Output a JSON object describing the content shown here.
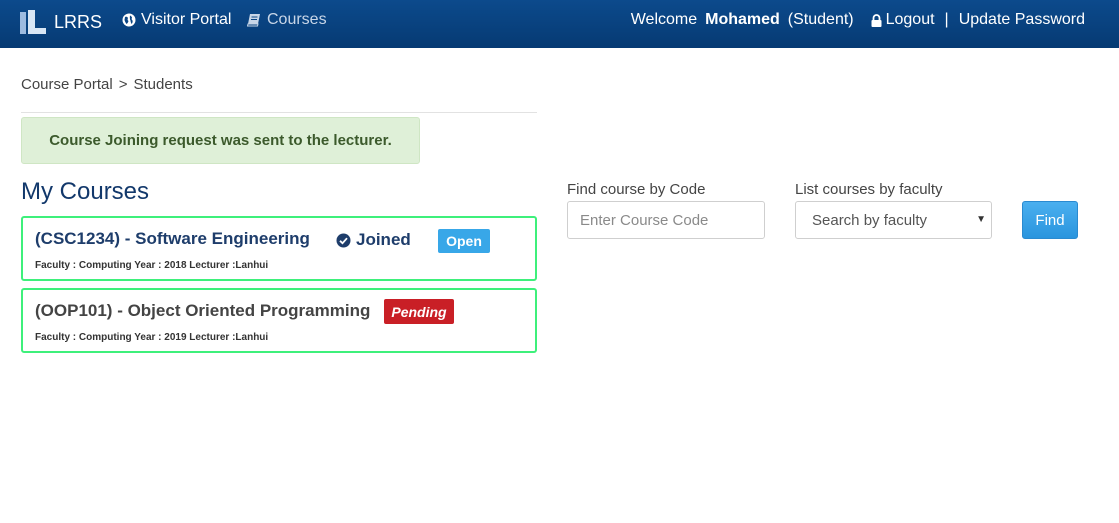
{
  "navbar": {
    "brand": "LRRS",
    "links": {
      "visitor_portal": "Visitor Portal",
      "courses": "Courses"
    },
    "welcome": "Welcome",
    "user_name": "Mohamed",
    "user_role": "(Student)",
    "logout": "Logout",
    "separator": "|",
    "update_password": "Update Password"
  },
  "breadcrumb": {
    "root": "Course Portal",
    "separator": ">",
    "current": "Students"
  },
  "alert": {
    "message": "Course Joining request was sent to the lecturer."
  },
  "my_courses": {
    "title": "My Courses",
    "courses": [
      {
        "title": "(CSC1234) - Software Engineering",
        "meta": "Faculty : Computing Year : 2018 Lecturer :Lanhui",
        "status_text": "Joined",
        "badge": "Open"
      },
      {
        "title": "(OOP101) - Object Oriented Programming",
        "meta": "Faculty : Computing Year : 2019 Lecturer :Lanhui",
        "badge": "Pending"
      }
    ]
  },
  "search": {
    "code_label": "Find course by Code",
    "code_placeholder": "Enter Course Code",
    "faculty_label": "List courses by faculty",
    "faculty_selected": "Search by faculty",
    "find_button": "Find"
  },
  "colors": {
    "navbar": "#0a4584",
    "open_badge": "#38a7e8",
    "pending_badge": "#c91f26",
    "card_border": "#3ef07b",
    "alert_bg": "#dff0d8"
  }
}
